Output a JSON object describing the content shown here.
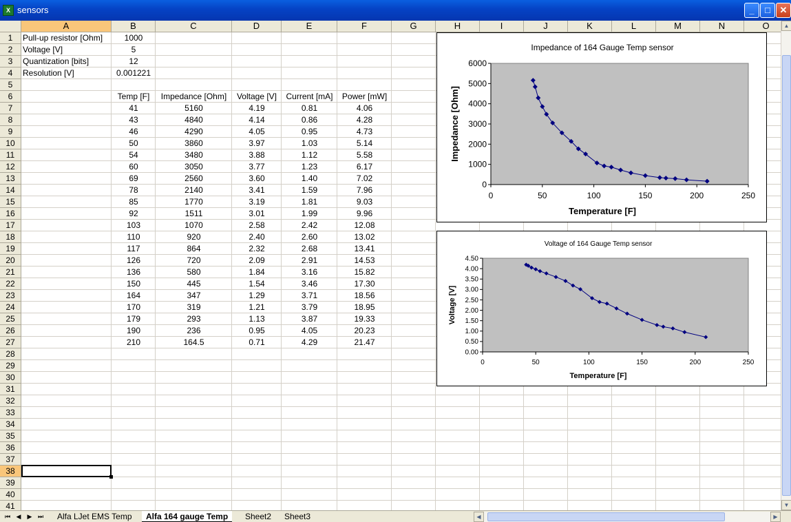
{
  "window": {
    "title": "sensors",
    "app_icon": "excel-icon",
    "minimize": "_",
    "maximize": "□",
    "close": "✕"
  },
  "columns": [
    "A",
    "B",
    "C",
    "D",
    "E",
    "F",
    "G",
    "H",
    "I",
    "J",
    "K",
    "L",
    "M",
    "N",
    "O"
  ],
  "rows": [
    "1",
    "2",
    "3",
    "4",
    "5",
    "6",
    "7",
    "8",
    "9",
    "10",
    "11",
    "12",
    "13",
    "14",
    "15",
    "16",
    "17",
    "18",
    "19",
    "20",
    "21",
    "22",
    "23",
    "24",
    "25",
    "26",
    "27",
    "28",
    "29",
    "30",
    "31",
    "32",
    "33",
    "34",
    "35",
    "36",
    "37",
    "38",
    "39",
    "40",
    "41"
  ],
  "active_row": "38",
  "active_column": "A",
  "params": [
    {
      "label": "Pull-up resistor [Ohm]",
      "value": "1000"
    },
    {
      "label": "Voltage [V]",
      "value": "5"
    },
    {
      "label": "Quantization [bits]",
      "value": "12"
    },
    {
      "label": "Resolution [V]",
      "value": "0.001221"
    }
  ],
  "table_headers": [
    "Temp [F]",
    "Impedance [Ohm]",
    "Voltage [V]",
    "Current [mA]",
    "Power [mW]"
  ],
  "table_rows": [
    [
      "41",
      "5160",
      "4.19",
      "0.81",
      "4.06"
    ],
    [
      "43",
      "4840",
      "4.14",
      "0.86",
      "4.28"
    ],
    [
      "46",
      "4290",
      "4.05",
      "0.95",
      "4.73"
    ],
    [
      "50",
      "3860",
      "3.97",
      "1.03",
      "5.14"
    ],
    [
      "54",
      "3480",
      "3.88",
      "1.12",
      "5.58"
    ],
    [
      "60",
      "3050",
      "3.77",
      "1.23",
      "6.17"
    ],
    [
      "69",
      "2560",
      "3.60",
      "1.40",
      "7.02"
    ],
    [
      "78",
      "2140",
      "3.41",
      "1.59",
      "7.96"
    ],
    [
      "85",
      "1770",
      "3.19",
      "1.81",
      "9.03"
    ],
    [
      "92",
      "1511",
      "3.01",
      "1.99",
      "9.96"
    ],
    [
      "103",
      "1070",
      "2.58",
      "2.42",
      "12.08"
    ],
    [
      "110",
      "920",
      "2.40",
      "2.60",
      "13.02"
    ],
    [
      "117",
      "864",
      "2.32",
      "2.68",
      "13.41"
    ],
    [
      "126",
      "720",
      "2.09",
      "2.91",
      "14.53"
    ],
    [
      "136",
      "580",
      "1.84",
      "3.16",
      "15.82"
    ],
    [
      "150",
      "445",
      "1.54",
      "3.46",
      "17.30"
    ],
    [
      "164",
      "347",
      "1.29",
      "3.71",
      "18.56"
    ],
    [
      "170",
      "319",
      "1.21",
      "3.79",
      "18.95"
    ],
    [
      "179",
      "293",
      "1.13",
      "3.87",
      "19.33"
    ],
    [
      "190",
      "236",
      "0.95",
      "4.05",
      "20.23"
    ],
    [
      "210",
      "164.5",
      "0.71",
      "4.29",
      "21.47"
    ]
  ],
  "chart_data": [
    {
      "type": "scatter",
      "title": "Impedance of 164 Gauge Temp sensor",
      "xlabel": "Temperature [F]",
      "ylabel": "Impedance [Ohm]",
      "xlim": [
        0,
        250
      ],
      "ylim": [
        0,
        6000
      ],
      "xticks": [
        "0",
        "50",
        "100",
        "150",
        "200",
        "250"
      ],
      "yticks": [
        "0",
        "1000",
        "2000",
        "3000",
        "4000",
        "5000",
        "6000"
      ],
      "x": [
        41,
        43,
        46,
        50,
        54,
        60,
        69,
        78,
        85,
        92,
        103,
        110,
        117,
        126,
        136,
        150,
        164,
        170,
        179,
        190,
        210
      ],
      "y": [
        5160,
        4840,
        4290,
        3860,
        3480,
        3050,
        2560,
        2140,
        1770,
        1511,
        1070,
        920,
        864,
        720,
        580,
        445,
        347,
        319,
        293,
        236,
        164.5
      ],
      "plot_color": "#c0c0c0",
      "series_color": "#000080"
    },
    {
      "type": "scatter",
      "title": "Voltage of 164 Gauge Temp sensor",
      "xlabel": "Temperature [F]",
      "ylabel": "Voltage [V]",
      "xlim": [
        0,
        250
      ],
      "ylim": [
        0,
        4.5
      ],
      "xticks": [
        "0",
        "50",
        "100",
        "150",
        "200",
        "250"
      ],
      "yticks": [
        "0.00",
        "0.50",
        "1.00",
        "1.50",
        "2.00",
        "2.50",
        "3.00",
        "3.50",
        "4.00",
        "4.50"
      ],
      "x": [
        41,
        43,
        46,
        50,
        54,
        60,
        69,
        78,
        85,
        92,
        103,
        110,
        117,
        126,
        136,
        150,
        164,
        170,
        179,
        190,
        210
      ],
      "y": [
        4.19,
        4.14,
        4.05,
        3.97,
        3.88,
        3.77,
        3.6,
        3.41,
        3.19,
        3.01,
        2.58,
        2.4,
        2.32,
        2.09,
        1.84,
        1.54,
        1.29,
        1.21,
        1.13,
        0.95,
        0.71
      ],
      "plot_color": "#c0c0c0",
      "series_color": "#000080"
    }
  ],
  "sheet_tabs": [
    "Alfa LJet EMS Temp",
    "Alfa 164 gauge Temp",
    "Sheet2",
    "Sheet3"
  ],
  "active_tab": "Alfa 164 gauge Temp",
  "tab_nav": [
    "⏮",
    "◀",
    "▶",
    "⏭"
  ]
}
